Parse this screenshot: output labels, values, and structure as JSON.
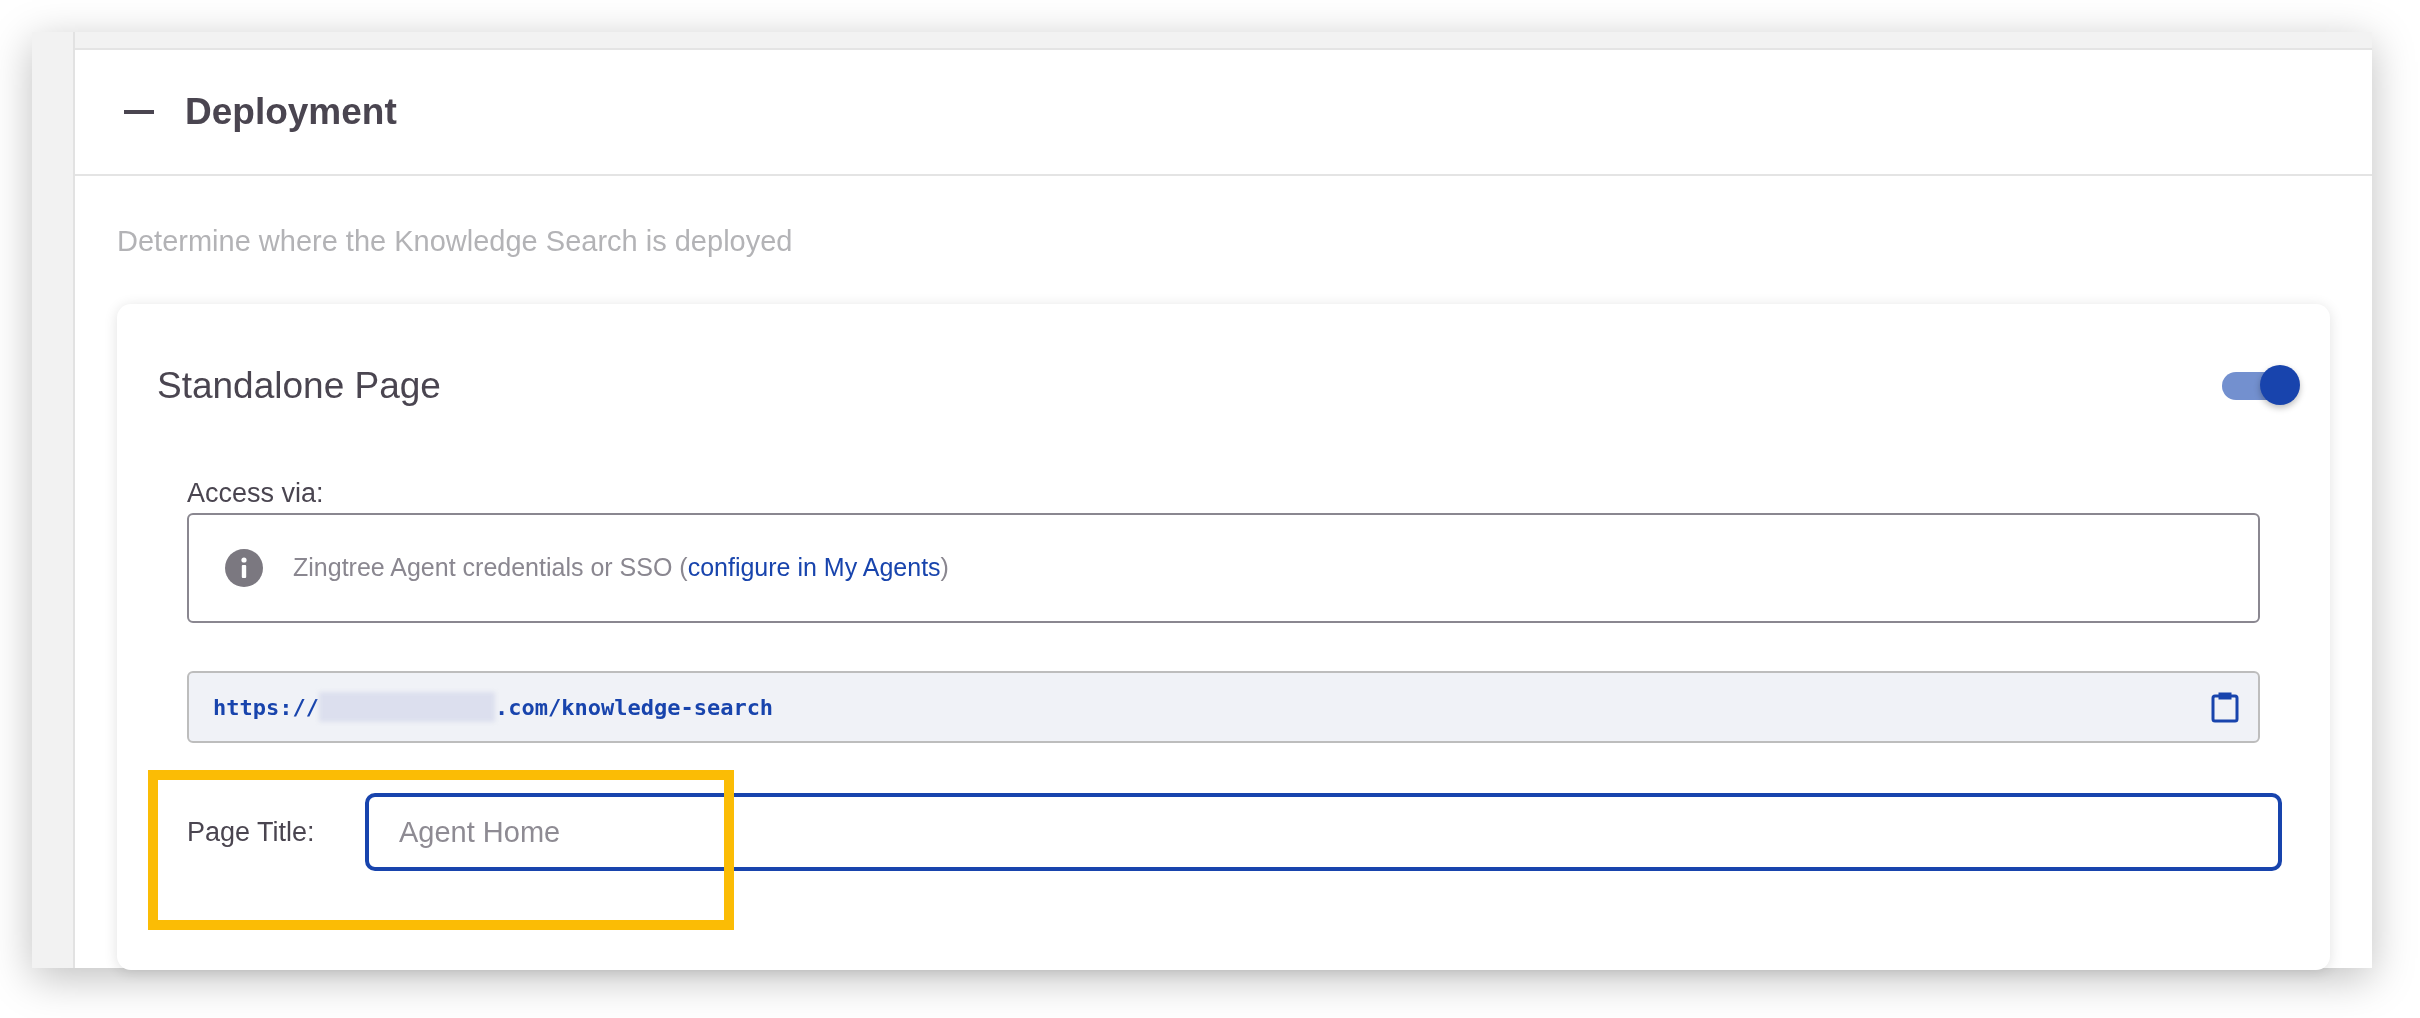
{
  "section": {
    "title": "Deployment",
    "expanded": true,
    "description": "Determine where the Knowledge Search is deployed"
  },
  "card": {
    "title": "Standalone Page",
    "toggle": {
      "on": true
    },
    "access_label": "Access via:",
    "access_info": {
      "text_before": "Zingtree Agent credentials or SSO (",
      "link": "configure in My Agents",
      "text_after": ")"
    },
    "url": {
      "prefix": "https://",
      "redacted": true,
      "suffix": ".com/knowledge-search"
    },
    "page_title": {
      "label": "Page Title:",
      "placeholder": "Agent Home",
      "focused": true
    }
  },
  "highlight": {
    "on": true
  }
}
